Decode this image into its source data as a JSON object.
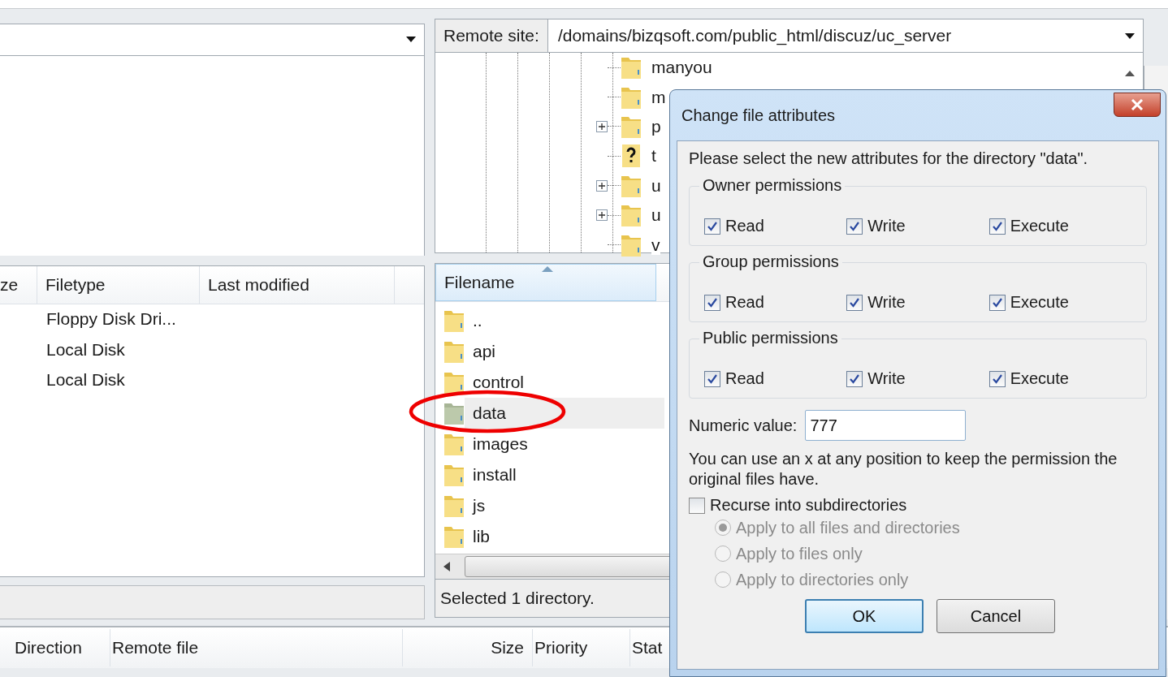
{
  "local_list": {
    "columns": [
      "ze",
      "Filetype",
      "Last modified"
    ],
    "rows": [
      {
        "filetype": "Floppy Disk Dri..."
      },
      {
        "filetype": "Local Disk"
      },
      {
        "filetype": "Local Disk"
      }
    ]
  },
  "remote_site": {
    "label": "Remote site:",
    "path": "/domains/bizqsoft.com/public_html/discuz/uc_server"
  },
  "remote_tree": {
    "items": [
      {
        "name": "manyou",
        "kind": "folder",
        "expandable": false
      },
      {
        "name": "m",
        "kind": "folder",
        "expandable": false
      },
      {
        "name": "p",
        "kind": "folder",
        "expandable": true
      },
      {
        "name": "t",
        "kind": "unknown",
        "expandable": false
      },
      {
        "name": "u",
        "kind": "folder",
        "expandable": true
      },
      {
        "name": "u",
        "kind": "folder",
        "expandable": true
      },
      {
        "name": "v",
        "kind": "folder",
        "expandable": false
      }
    ]
  },
  "remote_list": {
    "columns": [
      "Filename"
    ],
    "rows": [
      {
        "name": "..",
        "selected": false
      },
      {
        "name": "api",
        "selected": false
      },
      {
        "name": "control",
        "selected": false
      },
      {
        "name": "data",
        "selected": true
      },
      {
        "name": "images",
        "selected": false
      },
      {
        "name": "install",
        "selected": false
      },
      {
        "name": "js",
        "selected": false
      },
      {
        "name": "lib",
        "selected": false
      }
    ],
    "status": "Selected 1 directory."
  },
  "queue": {
    "columns": [
      "Direction",
      "Remote file",
      "Size",
      "Priority",
      "Stat"
    ]
  },
  "dialog": {
    "title": "Change file attributes",
    "intro": "Please select the new attributes for the directory \"data\".",
    "groups": [
      {
        "title": "Owner permissions",
        "options": [
          {
            "label": "Read",
            "checked": true
          },
          {
            "label": "Write",
            "checked": true
          },
          {
            "label": "Execute",
            "checked": true
          }
        ]
      },
      {
        "title": "Group permissions",
        "options": [
          {
            "label": "Read",
            "checked": true
          },
          {
            "label": "Write",
            "checked": true
          },
          {
            "label": "Execute",
            "checked": true
          }
        ]
      },
      {
        "title": "Public permissions",
        "options": [
          {
            "label": "Read",
            "checked": true
          },
          {
            "label": "Write",
            "checked": true
          },
          {
            "label": "Execute",
            "checked": true
          }
        ]
      }
    ],
    "numeric_label": "Numeric value:",
    "numeric_value": "777",
    "note": "You can use an x at any position to keep the permission the original files have.",
    "recurse": {
      "label": "Recurse into subdirectories",
      "checked": false
    },
    "apply_options": [
      {
        "label": "Apply to all files and directories",
        "selected": true,
        "disabled": true
      },
      {
        "label": "Apply to files only",
        "selected": false,
        "disabled": true
      },
      {
        "label": "Apply to directories only",
        "selected": false,
        "disabled": true
      }
    ],
    "buttons": [
      {
        "label": "OK",
        "default": true
      },
      {
        "label": "Cancel",
        "default": false
      }
    ]
  }
}
